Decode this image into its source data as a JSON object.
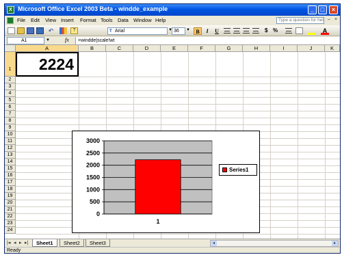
{
  "window": {
    "title": "Microsoft Office Excel 2003 Beta - windde_example"
  },
  "menu": {
    "items": [
      "File",
      "Edit",
      "View",
      "Insert",
      "Format",
      "Tools",
      "Data",
      "Window",
      "Help"
    ],
    "help_placeholder": "Type a question for help"
  },
  "toolbar": {
    "font_name": "Arial",
    "font_size": "36",
    "bold": "B",
    "italic": "I",
    "underline": "U",
    "currency": "$",
    "percent": "%"
  },
  "formula_bar": {
    "name_box": "A1",
    "fx": "fx",
    "formula": "=windde|scale!wt"
  },
  "grid": {
    "columns": [
      "A",
      "B",
      "C",
      "D",
      "E",
      "F",
      "G",
      "H",
      "I",
      "J",
      "K"
    ],
    "rows": [
      "1",
      "2",
      "3",
      "4",
      "5",
      "6",
      "7",
      "8",
      "9",
      "10",
      "11",
      "12",
      "13",
      "14",
      "15",
      "16",
      "17",
      "18",
      "19",
      "20",
      "21",
      "22",
      "23",
      "24"
    ],
    "cell_a1": "2224"
  },
  "chart_data": {
    "type": "bar",
    "categories": [
      "1"
    ],
    "series": [
      {
        "name": "Series1",
        "values": [
          2224
        ],
        "color": "#ff0000"
      }
    ],
    "y_ticks": [
      "0",
      "500",
      "1000",
      "1500",
      "2000",
      "2500",
      "3000"
    ],
    "ylim": [
      0,
      3000
    ],
    "grid": true,
    "plot_background": "#c0c0c0",
    "legend_position": "right"
  },
  "sheets": [
    "Sheet1",
    "Sheet2",
    "Sheet3"
  ],
  "active_sheet": "Sheet1",
  "status": "Ready",
  "colors": {
    "titlebar": "#0054e3",
    "chrome": "#ece9d8",
    "selection_header": "#f9d98c",
    "bar": "#ff0000"
  }
}
